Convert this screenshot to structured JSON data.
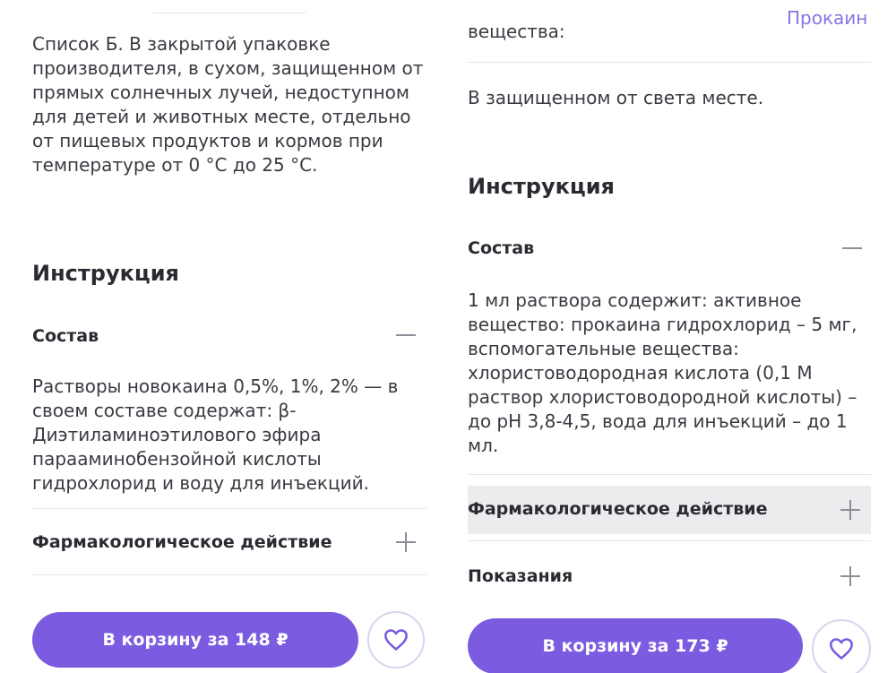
{
  "left": {
    "storage_text": "Список Б. В закрытой упаковке производителя, в сухом, защищенном от прямых солнечных лучей, недоступном для детей и животных месте, отдельно от пищевых продуктов и кормов при температуре от 0 °С до 25 °С.",
    "instruction_heading": "Инструкция",
    "composition_title": "Состав",
    "composition_text": "Растворы новокаина 0,5%, 1%, 2% — в своем составе содержат: β-Диэтиламиноэтилового эфира парааминобензойной кислоты гидрохлорид и воду для инъекций.",
    "pharm_title": "Фармакологическое действие",
    "cart_label": "В корзину за 148 ₽"
  },
  "right": {
    "top_label": "вещества:",
    "top_value": "Прокаин",
    "storage_text": "В защищенном от света месте.",
    "instruction_heading": "Инструкция",
    "composition_title": "Состав",
    "composition_text": "1 мл раствора содержит:   активное вещество:   прокаина гидрохлорид – 5 мг,  вспомогательные вещества: хлористоводородная кислота   (0,1 М раствор хлористоводородной кислоты) – до pH 3,8-4,5,   вода для инъекций – до 1 мл.",
    "pharm_title": "Фармакологическое действие",
    "indications_title": "Показания",
    "cart_label": "В корзину за 173 ₽"
  },
  "colors": {
    "accent": "#7b5ce0",
    "accent_text": "#8a72e6",
    "divider": "#e6e6ea",
    "highlight": "#ececee"
  },
  "icons": {
    "expanded": "minus-icon",
    "collapsed": "plus-icon",
    "favorite": "heart-icon"
  }
}
